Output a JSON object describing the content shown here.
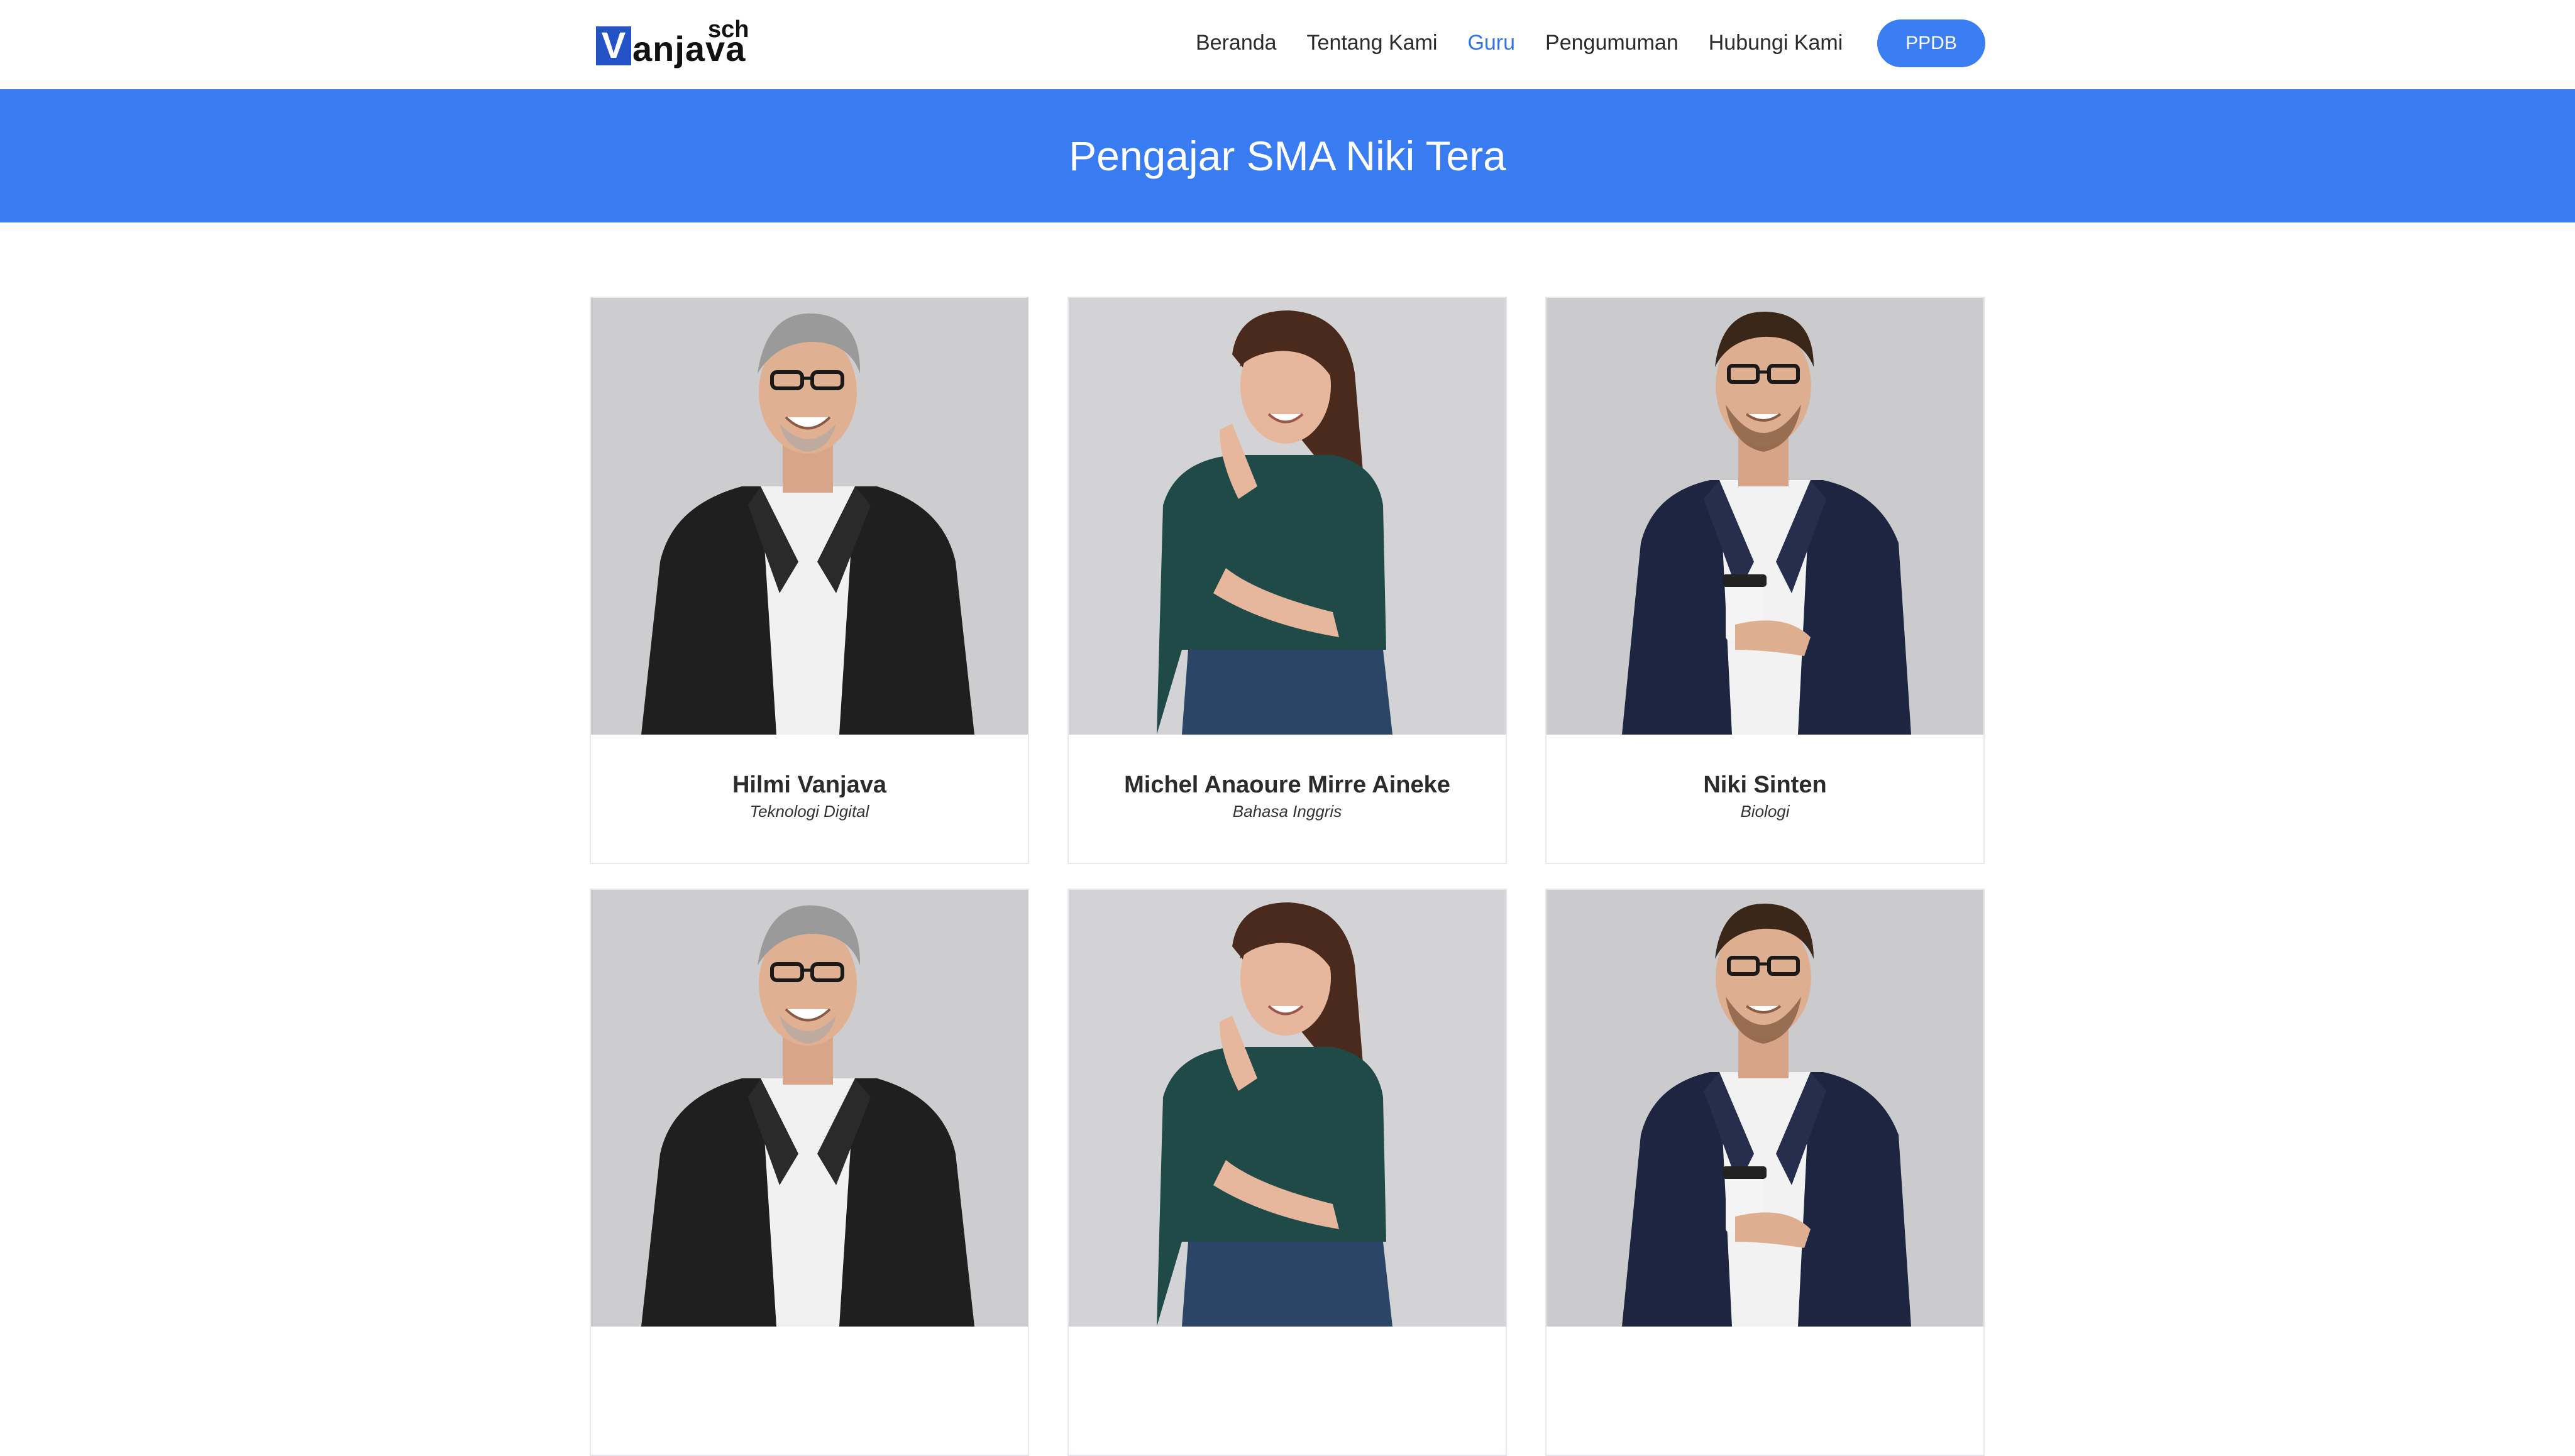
{
  "brand": {
    "logo_letter": "V",
    "logo_text": "anjava",
    "logo_suffix": "sch"
  },
  "nav": {
    "items": [
      {
        "label": "Beranda",
        "active": false
      },
      {
        "label": "Tentang Kami",
        "active": false
      },
      {
        "label": "Guru",
        "active": true
      },
      {
        "label": "Pengumuman",
        "active": false
      },
      {
        "label": "Hubungi Kami",
        "active": false
      }
    ],
    "cta_label": "PPDB"
  },
  "banner": {
    "title": "Pengajar SMA Niki Tera"
  },
  "teachers": [
    {
      "name": "Hilmi Vanjava",
      "subject": "Teknologi Digital",
      "photo": "teacher-photo-man-gray-hair"
    },
    {
      "name": "Michel Anaoure Mirre Aineke",
      "subject": "Bahasa Inggris",
      "photo": "teacher-photo-woman-long-hair"
    },
    {
      "name": "Niki Sinten",
      "subject": "Biologi",
      "photo": "teacher-photo-man-coffee-cup"
    },
    {
      "name": "",
      "subject": "",
      "photo": "teacher-photo-man-gray-hair"
    },
    {
      "name": "",
      "subject": "",
      "photo": "teacher-photo-woman-long-hair"
    },
    {
      "name": "",
      "subject": "",
      "photo": "teacher-photo-man-coffee-cup"
    }
  ],
  "colors": {
    "accent": "#397cf2",
    "active_nav": "#2f75e8",
    "logo_box": "#2453c6"
  }
}
